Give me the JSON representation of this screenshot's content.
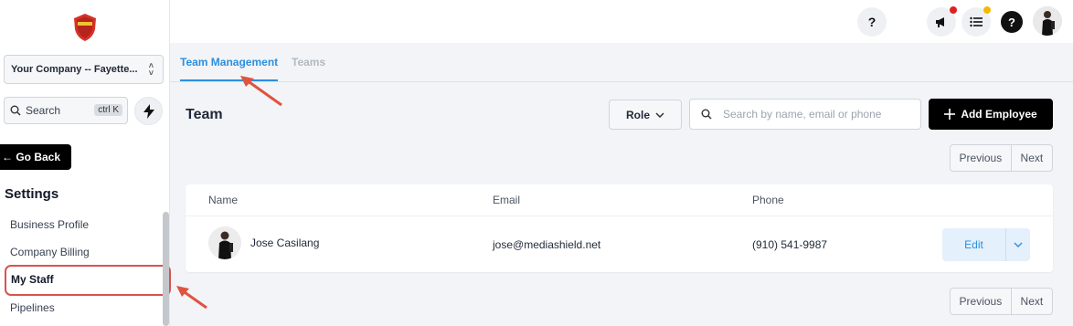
{
  "sidebar": {
    "company_select": "Your Company -- Fayette...",
    "search_label": "Search",
    "search_shortcut": "ctrl K",
    "go_back": "← Go Back",
    "settings_title": "Settings",
    "items": [
      {
        "label": "Business Profile"
      },
      {
        "label": "Company Billing"
      },
      {
        "label": "My Staff",
        "active": true
      },
      {
        "label": "Pipelines"
      }
    ]
  },
  "topbar": {
    "help_label": "?",
    "help2_label": "?"
  },
  "tabs": [
    {
      "label": "Team Management",
      "active": true
    },
    {
      "label": "Teams",
      "active": false
    }
  ],
  "main": {
    "title": "Team",
    "role_filter": "Role",
    "search_placeholder": "Search by name, email or phone",
    "add_button": "Add Employee",
    "pager": {
      "previous": "Previous",
      "next": "Next"
    },
    "table": {
      "headers": [
        "Name",
        "Email",
        "Phone"
      ],
      "rows": [
        {
          "name": "Jose Casilang",
          "email": "jose@mediashield.net",
          "phone": "(910) 541-9987",
          "action": "Edit"
        }
      ]
    }
  },
  "colors": {
    "accent": "#2b8fe0",
    "annotation": "#e0533f",
    "notification_red": "#e02020",
    "notification_yellow": "#f5b800"
  }
}
